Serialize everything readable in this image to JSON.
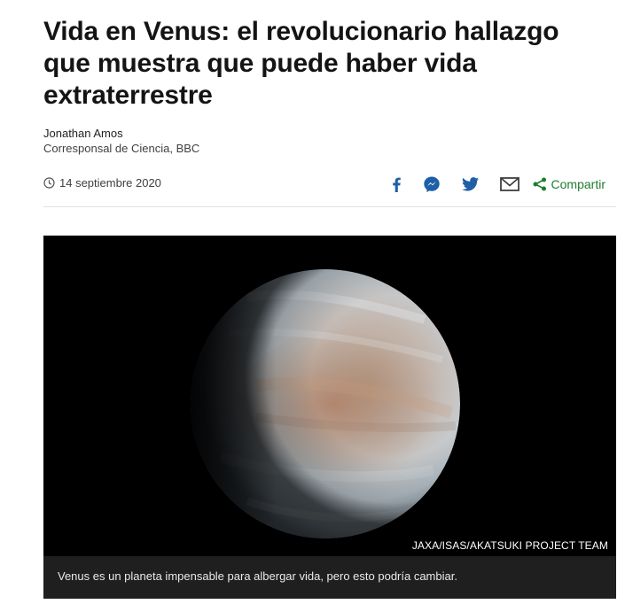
{
  "article": {
    "headline": "Vida en Venus: el revolucionario hallazgo que muestra que puede haber vida extraterrestre",
    "author": "Jonathan Amos",
    "role": "Corresponsal de Ciencia, BBC",
    "date": "14 septiembre 2020"
  },
  "share": {
    "facebook_icon": "facebook-icon",
    "messenger_icon": "messenger-icon",
    "twitter_icon": "twitter-icon",
    "email_icon": "email-icon",
    "share_icon": "share-icon",
    "more_label": "Compartir",
    "icon_color": "#1e5fa8",
    "accent": "#1d7d2e"
  },
  "figure": {
    "image_icon": "venus-planet-image",
    "credit": "JAXA/ISAS/AKATSUKI PROJECT TEAM",
    "caption": "Venus es un planeta impensable para albergar vida, pero esto podría cambiar."
  }
}
